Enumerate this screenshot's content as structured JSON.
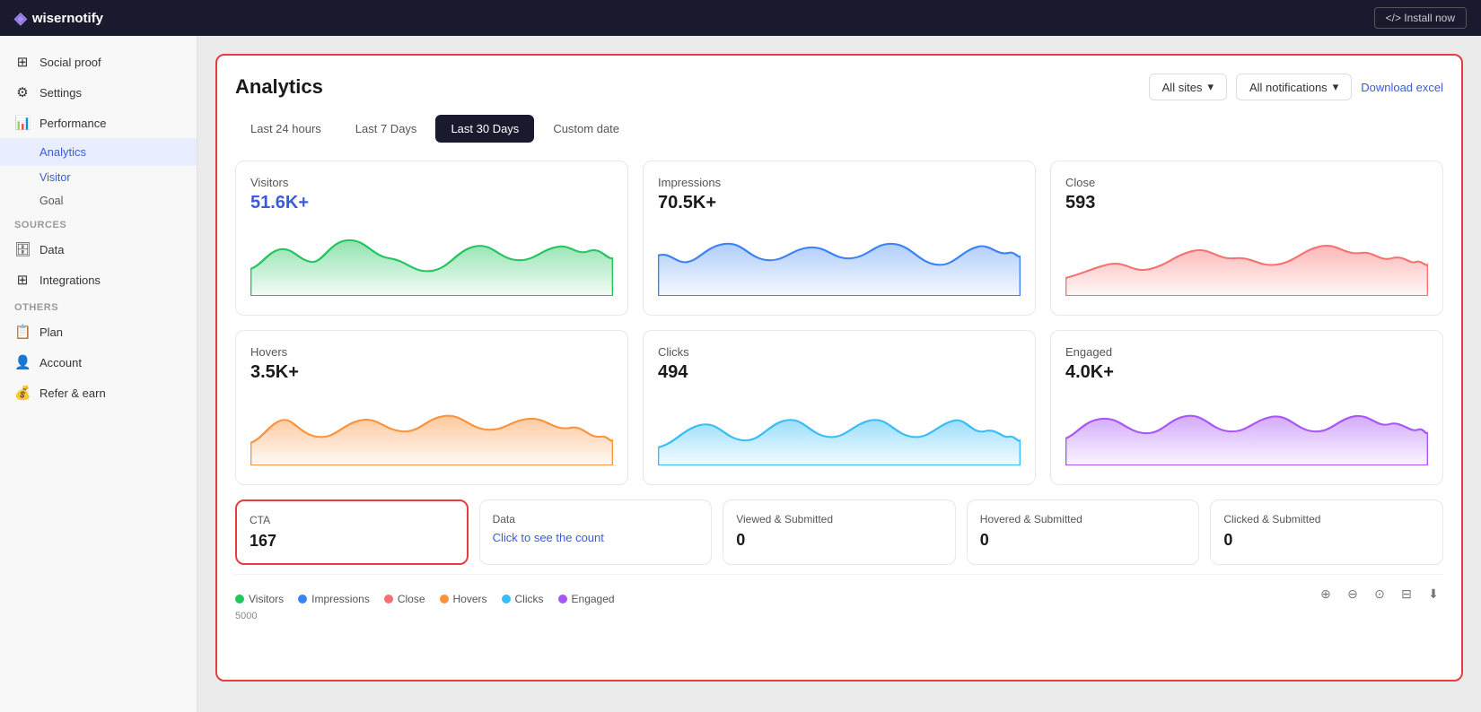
{
  "topbar": {
    "logo": "wisernotify",
    "install_btn": "</> Install now"
  },
  "sidebar": {
    "items": [
      {
        "id": "social-proof",
        "label": "Social proof",
        "icon": "⊞"
      },
      {
        "id": "settings",
        "label": "Settings",
        "icon": "⚙"
      },
      {
        "id": "performance",
        "label": "Performance",
        "icon": "📊"
      },
      {
        "id": "analytics",
        "label": "Analytics",
        "icon": "",
        "active": true
      },
      {
        "id": "visitor",
        "label": "Visitor",
        "sub": true
      },
      {
        "id": "goal",
        "label": "Goal",
        "sub": true
      }
    ],
    "sources_label": "Sources",
    "sources": [
      {
        "id": "data",
        "label": "Data",
        "icon": "🗄"
      },
      {
        "id": "integrations",
        "label": "Integrations",
        "icon": "⊞"
      }
    ],
    "others_label": "Others",
    "others": [
      {
        "id": "plan",
        "label": "Plan",
        "icon": "📋"
      },
      {
        "id": "account",
        "label": "Account",
        "icon": "👤"
      },
      {
        "id": "refer",
        "label": "Refer & earn",
        "icon": "💰"
      }
    ]
  },
  "analytics": {
    "title": "Analytics",
    "all_sites_label": "All sites",
    "all_notifications_label": "All notifications",
    "download_label": "Download excel",
    "tabs": [
      {
        "id": "24h",
        "label": "Last 24 hours"
      },
      {
        "id": "7d",
        "label": "Last 7 Days"
      },
      {
        "id": "30d",
        "label": "Last 30 Days",
        "active": true
      },
      {
        "id": "custom",
        "label": "Custom date"
      }
    ],
    "stats": [
      {
        "id": "visitors",
        "label": "Visitors",
        "value": "51.6K+",
        "value_class": "blue",
        "color": "#22c55e",
        "fill": "#bbf7d0",
        "chart_type": "area"
      },
      {
        "id": "impressions",
        "label": "Impressions",
        "value": "70.5K+",
        "value_class": "",
        "color": "#3b82f6",
        "fill": "#bfdbfe",
        "chart_type": "area"
      },
      {
        "id": "close",
        "label": "Close",
        "value": "593",
        "value_class": "",
        "color": "#f87171",
        "fill": "#fecaca",
        "chart_type": "area"
      },
      {
        "id": "hovers",
        "label": "Hovers",
        "value": "3.5K+",
        "value_class": "",
        "color": "#fb923c",
        "fill": "#fed7aa",
        "chart_type": "area"
      },
      {
        "id": "clicks",
        "label": "Clicks",
        "value": "494",
        "value_class": "",
        "color": "#38bdf8",
        "fill": "#bae6fd",
        "chart_type": "area"
      },
      {
        "id": "engaged",
        "label": "Engaged",
        "value": "4.0K+",
        "value_class": "",
        "color": "#a855f7",
        "fill": "#e9d5ff",
        "chart_type": "area"
      }
    ],
    "bottom_cards": [
      {
        "id": "cta",
        "label": "CTA",
        "value": "167",
        "highlighted": true
      },
      {
        "id": "data",
        "label": "Data",
        "value": "Click to see the count",
        "is_link": true
      },
      {
        "id": "viewed-submitted",
        "label": "Viewed & Submitted",
        "value": "0"
      },
      {
        "id": "hovered-submitted",
        "label": "Hovered & Submitted",
        "value": "0"
      },
      {
        "id": "clicked-submitted",
        "label": "Clicked & Submitted",
        "value": "0"
      }
    ],
    "legend": [
      {
        "label": "Visitors",
        "color": "#22c55e"
      },
      {
        "label": "Impressions",
        "color": "#3b82f6"
      },
      {
        "label": "Close",
        "color": "#f87171"
      },
      {
        "label": "Hovers",
        "color": "#fb923c"
      },
      {
        "label": "Clicks",
        "color": "#38bdf8"
      },
      {
        "label": "Engaged",
        "color": "#a855f7"
      }
    ],
    "y_axis": "5000"
  }
}
